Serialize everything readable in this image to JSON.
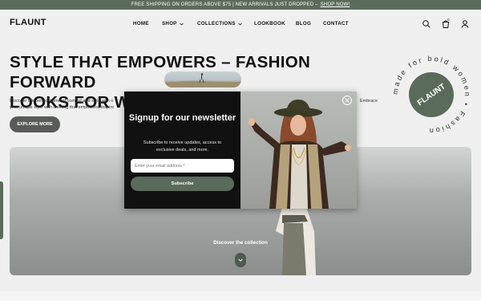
{
  "announcement": {
    "text": "FREE SHIPPING ON ORDERS ABOVE $75 | NEW ARRIVALS JUST DROPPED –",
    "link": "SHOP NOW!"
  },
  "header": {
    "logo": "FLAUNT",
    "nav": [
      {
        "label": "HOME",
        "has_dropdown": false
      },
      {
        "label": "SHOP",
        "has_dropdown": true
      },
      {
        "label": "COLLECTIONS",
        "has_dropdown": true
      },
      {
        "label": "LOOKBOOK",
        "has_dropdown": false
      },
      {
        "label": "BLOG",
        "has_dropdown": false
      },
      {
        "label": "CONTACT",
        "has_dropdown": false
      }
    ],
    "cart_count": "0",
    "icons": [
      "search-icon",
      "cart-icon",
      "account-icon"
    ]
  },
  "hero": {
    "headline_line1": "STYLE THAT EMPOWERS – FASHION FORWARD",
    "headline_line2": "LOOKS FOR WOMEN",
    "intro_left": "Discover the perfect blend of comfort and style with o",
    "intro_left_2": "your unique style with clothing that empowers, inspire",
    "intro_right": "Embrace",
    "explore_button": "EXPLORE MORE",
    "badge_text": "made for bold women • Fashion",
    "badge_center": "FLAUNT"
  },
  "banner": {
    "cta": "Discover the collection"
  },
  "modal": {
    "title": "Signup for our newsletter",
    "subtitle": "Subscribe to receive updates, access to exclusive deals, and more.",
    "email_placeholder": "Enter your email address *",
    "subscribe_button": "Subscribe"
  },
  "colors": {
    "accent": "#5b6b5b",
    "dark": "#111111",
    "background": "#efefef"
  }
}
